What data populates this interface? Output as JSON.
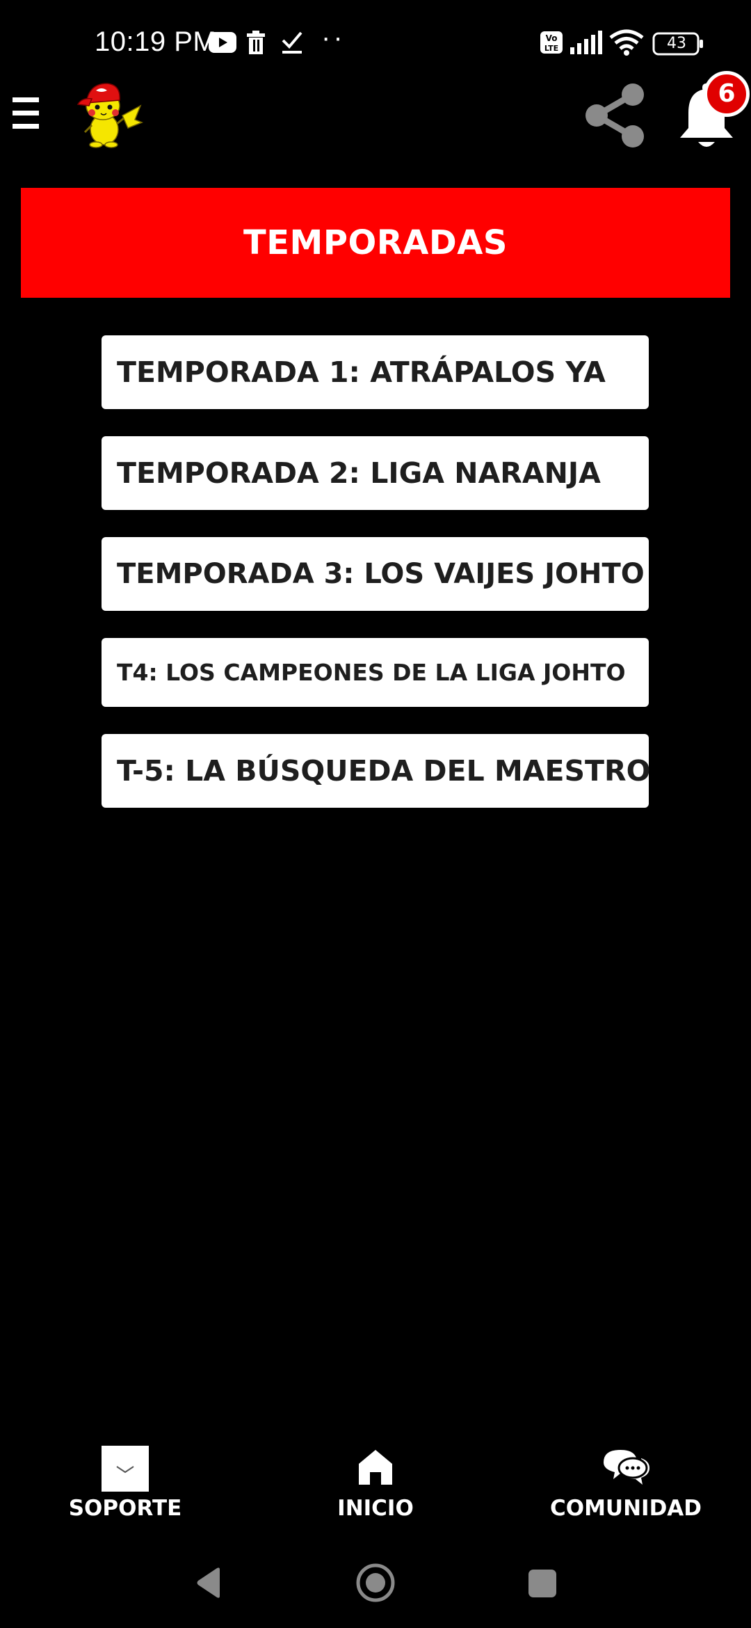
{
  "status_bar": {
    "time": "10:19 PM",
    "dots": "··",
    "battery_level": "43",
    "icons": [
      "youtube-icon",
      "trash-icon",
      "check-icon",
      "volte-icon",
      "signal-icon",
      "wifi-icon",
      "battery-icon"
    ]
  },
  "header": {
    "badge_count": "6",
    "icons": [
      "menu-icon",
      "pikachu-logo",
      "share-icon",
      "bell-icon"
    ]
  },
  "banner": {
    "title": "TEMPORADAS",
    "color": "#ff0000"
  },
  "seasons": [
    {
      "label": "TEMPORADA 1: ATRÁPALOS YA"
    },
    {
      "label": "TEMPORADA 2: LIGA NARANJA"
    },
    {
      "label": "TEMPORADA 3: LOS VAIJES JOHTO"
    },
    {
      "label": "T4: LOS CAMPEONES DE LA LIGA JOHTO"
    },
    {
      "label": "T-5: LA BÚSQUEDA DEL MAESTRO"
    }
  ],
  "bottom_nav": {
    "items": [
      {
        "label": "SOPORTE",
        "icon": "envelope-icon"
      },
      {
        "label": "INICIO",
        "icon": "home-icon"
      },
      {
        "label": "COMUNIDAD",
        "icon": "chat-icon"
      }
    ]
  },
  "system_nav": {
    "icons": [
      "back-icon",
      "home-circle-icon",
      "recents-icon"
    ]
  }
}
